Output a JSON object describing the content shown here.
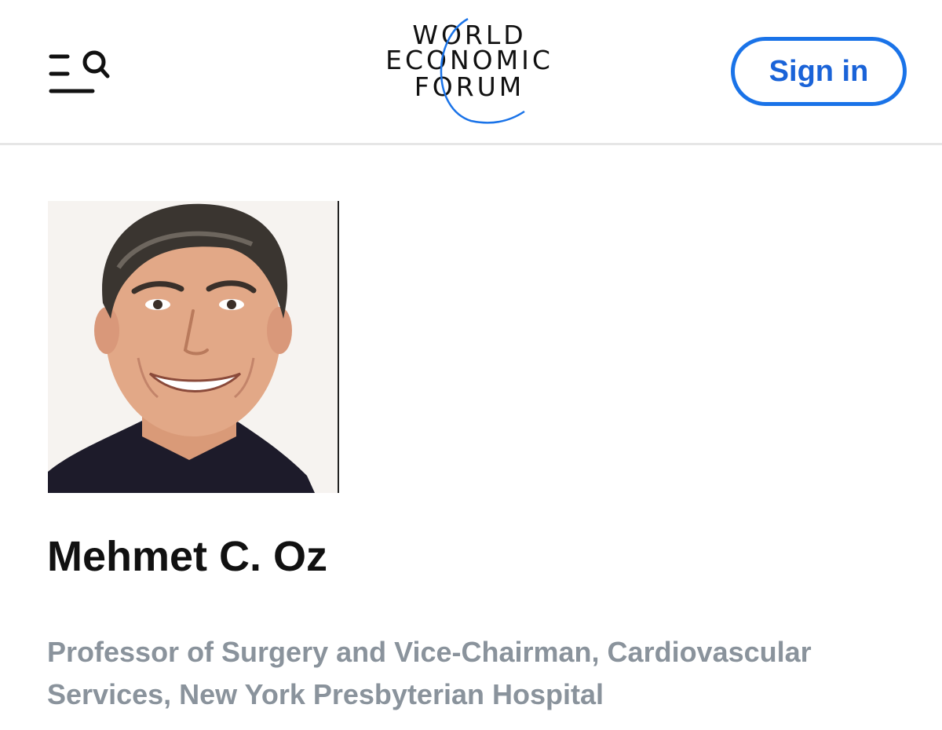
{
  "header": {
    "logo": {
      "line1": "WORLD",
      "line2": "ECONOMIC",
      "line3": "FORUM"
    },
    "menu_icon": "menu-search-icon",
    "signin_label": "Sign in"
  },
  "profile": {
    "name": "Mehmet C. Oz",
    "title": "Professor of Surgery and Vice-Chairman, Cardiovascular Services, New York Presbyterian Hospital"
  },
  "colors": {
    "accent": "#1a73e8",
    "name_text": "#111111",
    "subtitle_text": "#8a939c",
    "divider": "#e6e6e6"
  }
}
